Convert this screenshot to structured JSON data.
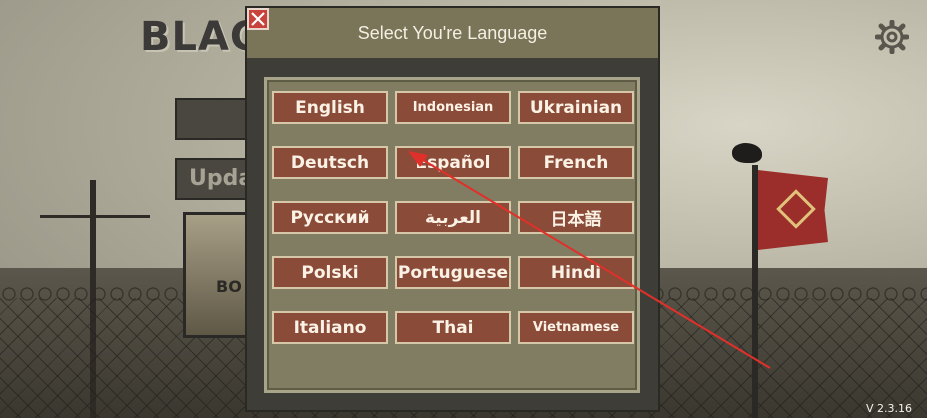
{
  "background": {
    "logo_text": "BLACK",
    "menu_button_2_text": "Upda",
    "poster_text": "BO"
  },
  "dialog": {
    "title": "Select You're Language",
    "close_icon": "close-x-icon",
    "languages": [
      [
        "English",
        "Indonesian",
        "Ukrainian"
      ],
      [
        "Deutsch",
        "Español",
        "French"
      ],
      [
        "Русский",
        "العربية",
        "日本語"
      ],
      [
        "Polski",
        "Portuguese",
        "Hindi"
      ],
      [
        "Italiano",
        "Thai",
        "Vietnamese"
      ]
    ]
  },
  "settings": {
    "icon": "gear-icon"
  },
  "version": "V 2.3.16",
  "colors": {
    "button_fill": "#8a4b39",
    "header_fill": "#7a7559",
    "arrow": "#e0302a"
  }
}
